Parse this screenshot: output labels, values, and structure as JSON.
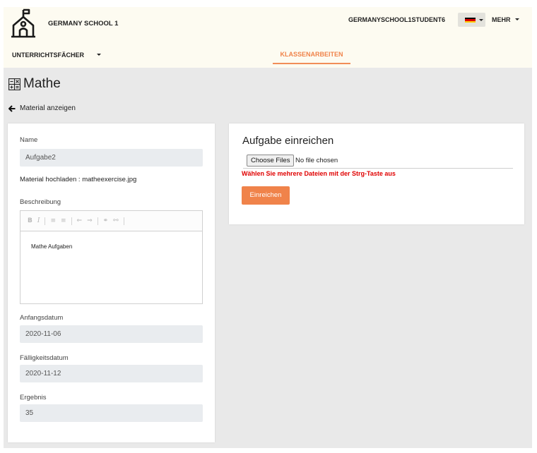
{
  "header": {
    "school_name": "GERMANY SCHOOL 1",
    "user_name": "GERMANYSCHOOL1STUDENT6",
    "more_label": "MEHR",
    "subjects_label": "UNTERRICHTSFÄCHER",
    "active_tab": "KLASSENARBEITEN",
    "flag_colors": [
      "#000000",
      "#dd0000",
      "#ffce00"
    ]
  },
  "page": {
    "title": "Mathe",
    "back_label": "Material anzeigen"
  },
  "details": {
    "name_label": "Name",
    "name_value": "Aufgabe2",
    "upload_text": "Material hochladen : matheexercise.jpg",
    "description_label": "Beschreibung",
    "editor_toolbar": [
      "B",
      "I",
      "ordered-list-icon",
      "bullet-list-icon",
      "outdent-icon",
      "indent-icon",
      "link-icon",
      "unlink-icon"
    ],
    "description_value": "Mathe Aufgaben",
    "start_label": "Anfangsdatum",
    "start_value": "2020-11-06",
    "due_label": "Fälligkeitsdatum",
    "due_value": "2020-11-12",
    "result_label": "Ergebnis",
    "result_value": "35"
  },
  "submission": {
    "title": "Aufgabe einreichen",
    "choose_files_label": "Choose Files",
    "no_file_text": "No file chosen",
    "hint": "Wählen Sie mehrere Dateien mit der Strg-Taste aus",
    "submit_label": "Einreichen",
    "accent_color": "#f0834a"
  }
}
